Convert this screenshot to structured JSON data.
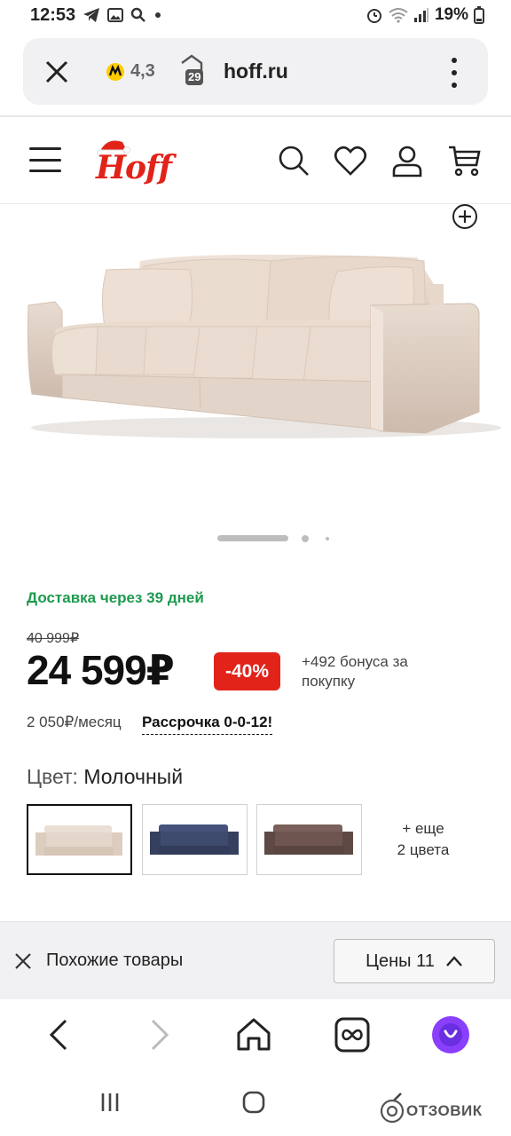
{
  "status_bar": {
    "time": "12:53",
    "battery": "19%"
  },
  "url_bar": {
    "rating": "4,3",
    "security_count": "29",
    "domain": "hoff.ru"
  },
  "header": {
    "logo_text": "Hoff"
  },
  "product": {
    "delivery": "Доставка через 39 дней",
    "old_price": "40 999₽",
    "price": "24 599₽",
    "discount": "-40%",
    "bonus": "+492 бонуса за покупку",
    "monthly": "2 050₽/месяц",
    "installment": "Рассрочка 0-0-12!",
    "color_prefix": "Цвет:",
    "color_value": "Молочный",
    "more_colors_line1": "+ еще",
    "more_colors_line2": "2 цвета",
    "swatches": [
      {
        "name": "Молочный",
        "color": "#e6dcd2"
      },
      {
        "name": "blue",
        "color": "#3f4c6e"
      },
      {
        "name": "brown",
        "color": "#6e5550"
      }
    ],
    "carousel": {
      "slides": 3,
      "active": 1
    }
  },
  "similar_bar": {
    "label": "Похожие товары",
    "prices_button": "Цены 11"
  },
  "watermark": {
    "text": "ОТЗОВИК"
  },
  "colors": {
    "brand_red": "#e2231a",
    "delivery_green": "#1d9a4f",
    "alice_purple": "#8a3ffc"
  }
}
